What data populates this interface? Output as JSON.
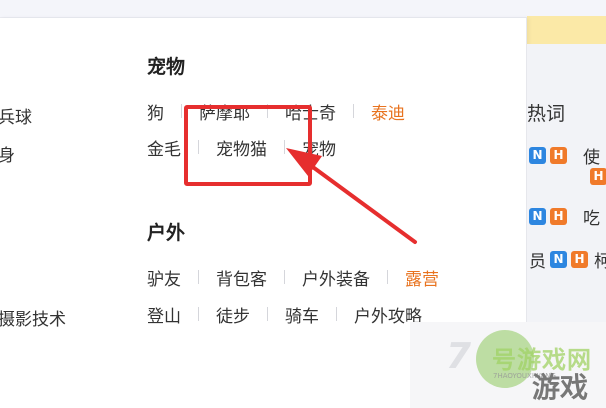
{
  "sidebar_fragments": [
    "兵球",
    "身",
    "摄影技术"
  ],
  "categories": {
    "pets": {
      "title": "宠物",
      "row1": [
        "狗",
        "萨摩耶",
        "哈士奇",
        "泰迪"
      ],
      "row2": [
        "金毛",
        "宠物猫",
        "宠物"
      ]
    },
    "outdoor": {
      "title": "户外",
      "row1": [
        "驴友",
        "背包客",
        "户外装备",
        "露营"
      ],
      "row2": [
        "登山",
        "徒步",
        "骑车",
        "户外攻略"
      ]
    }
  },
  "hot_panel": {
    "title": "热词",
    "badge_n": "N",
    "badge_h": "H",
    "row3_prefix": "员",
    "text_fragments": [
      "使",
      "吃",
      "柯"
    ]
  },
  "watermark": {
    "number": "7",
    "name": "号游戏网",
    "domain": "7HAOYOUXIWANG",
    "game": "游戏"
  },
  "colors": {
    "hot_tag": "#e8731f",
    "highlight": "#e62e2e",
    "badge_n": "#2d86e0",
    "badge_h": "#f07a2a"
  }
}
